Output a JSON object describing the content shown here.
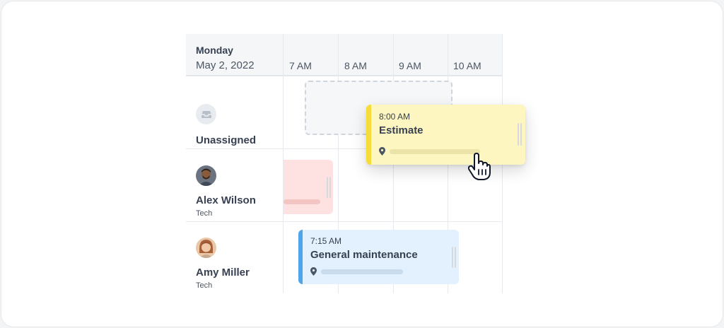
{
  "header": {
    "day": "Monday",
    "date": "May 2, 2022",
    "times": [
      "7 AM",
      "8 AM",
      "9 AM",
      "10 AM"
    ]
  },
  "rows": [
    {
      "name": "Unassigned",
      "role": ""
    },
    {
      "name": "Alex Wilson",
      "role": "Tech"
    },
    {
      "name": "Amy Miller",
      "role": "Tech"
    }
  ],
  "events": {
    "dragged": {
      "time": "8:00 AM",
      "title": "Estimate",
      "color": "#f5dc3a",
      "bg": "#fdf6c0"
    },
    "maintenance": {
      "time": "7:15 AM",
      "title": "General maintenance",
      "color": "#4fa5ea",
      "bg": "#e3f0fd"
    },
    "alex_job": {
      "color": "#fde2e1"
    }
  },
  "icons": {
    "unassigned": "inbox-icon",
    "location": "map-pin-icon",
    "cursor": "hand-pointer-icon"
  }
}
